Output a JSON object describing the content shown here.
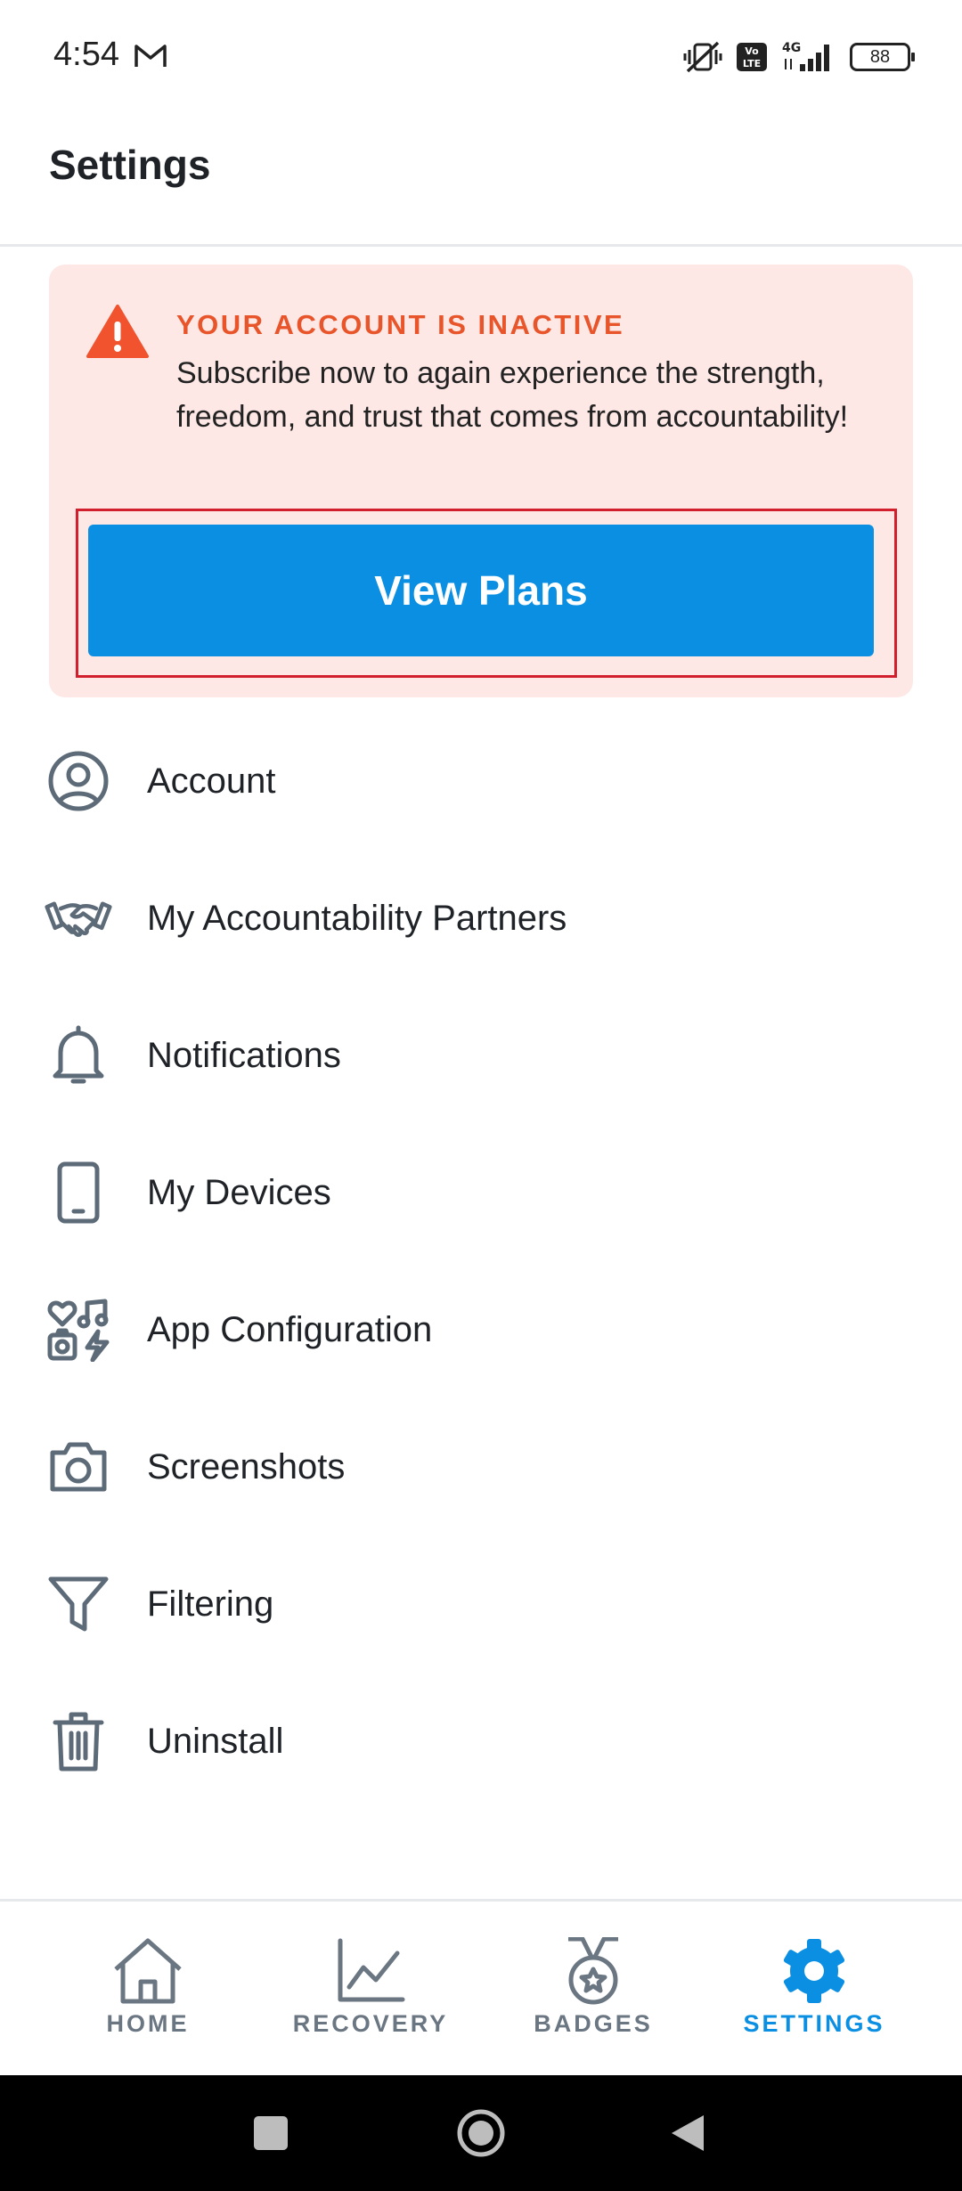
{
  "status_bar": {
    "time": "4:54",
    "battery": "88",
    "network": "4G"
  },
  "header": {
    "title": "Settings"
  },
  "alert": {
    "title": "YOUR ACCOUNT IS INACTIVE",
    "body": "Subscribe now to again experience the strength, freedom, and trust that comes from accountability!",
    "button_label": "View Plans",
    "accent_color": "#e9552a",
    "background_color": "#fde8e6",
    "button_color": "#0a8fe3"
  },
  "settings_items": [
    {
      "label": "Account",
      "icon": "user-circle-icon"
    },
    {
      "label": "My Accountability Partners",
      "icon": "handshake-icon"
    },
    {
      "label": "Notifications",
      "icon": "bell-icon"
    },
    {
      "label": "My Devices",
      "icon": "phone-icon"
    },
    {
      "label": "App Configuration",
      "icon": "app-configuration-icon"
    },
    {
      "label": "Screenshots",
      "icon": "camera-icon"
    },
    {
      "label": "Filtering",
      "icon": "filter-icon"
    },
    {
      "label": "Uninstall",
      "icon": "trash-icon"
    }
  ],
  "bottom_nav": {
    "items": [
      {
        "label": "HOME",
        "icon": "home-icon"
      },
      {
        "label": "RECOVERY",
        "icon": "chart-line-icon"
      },
      {
        "label": "BADGES",
        "icon": "medal-icon"
      },
      {
        "label": "SETTINGS",
        "icon": "gear-icon"
      }
    ],
    "active": "SETTINGS",
    "active_color": "#0a8fe3",
    "inactive_color": "#6b7683"
  }
}
